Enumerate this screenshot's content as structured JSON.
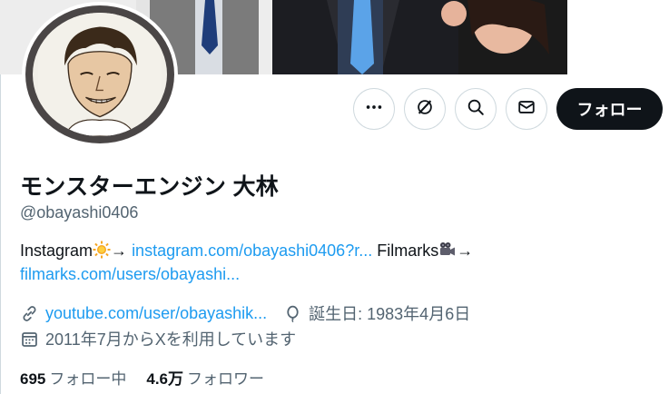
{
  "profile": {
    "display_name": "モンスターエンジン 大林",
    "handle": "@obayashi0406",
    "bio": {
      "part1": "Instagram",
      "arrow1": "→ ",
      "link1": "instagram.com/obayashi0406?r...",
      "part2": " Filmarks",
      "arrow2": "→",
      "link2": "filmarks.com/users/obayashi..."
    },
    "website": "youtube.com/user/obayashik...",
    "birthday": "誕生日: 1983年4月6日",
    "joined": "2011年7月からXを利用しています"
  },
  "stats": {
    "following_count": "695",
    "following_label": "フォロー中",
    "followers_count": "4.6万",
    "followers_label": "フォロワー"
  },
  "actions": {
    "follow_label": "フォロー"
  },
  "icons": {
    "more": "more-icon",
    "grok": "grok-icon",
    "search": "search-icon",
    "message": "message-icon",
    "link": "link-icon",
    "balloon": "balloon-icon",
    "calendar": "calendar-icon",
    "sun_emoji": "sun-emoji",
    "camera_emoji": "movie-camera-emoji"
  },
  "colors": {
    "link": "#1d9bf0",
    "secondary_text": "#536471",
    "primary_text": "#0f1419",
    "follow_bg": "#0f1419"
  }
}
